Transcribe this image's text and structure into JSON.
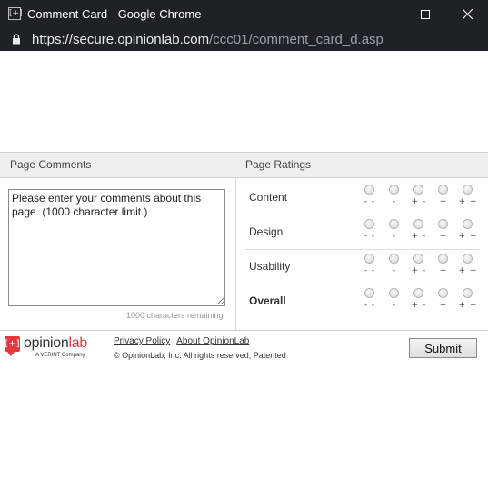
{
  "window": {
    "title": "Comment Card - Google Chrome",
    "url_host": "https://secure.opinionlab.com",
    "url_path": "/ccc01/comment_card_d.asp"
  },
  "comments": {
    "header": "Page Comments",
    "placeholder": "Please enter your comments about this page. (1000 character limit.)",
    "remaining": "1000 characters remaining."
  },
  "ratings": {
    "header": "Page Ratings",
    "scale": [
      "- -",
      "-",
      "+ -",
      "+",
      "+ +"
    ],
    "rows": [
      {
        "label": "Content"
      },
      {
        "label": "Design"
      },
      {
        "label": "Usability"
      },
      {
        "label": "Overall"
      }
    ]
  },
  "footer": {
    "logo_mark": "[+]",
    "logo_name_a": "opinion",
    "logo_name_b": "lab",
    "logo_sub": "A VERINT Company",
    "privacy_link": "Privacy Policy",
    "about_link": "About OpinionLab",
    "copyright": "© OpinionLab, Inc. All rights reserved; Patented",
    "submit_label": "Submit"
  }
}
